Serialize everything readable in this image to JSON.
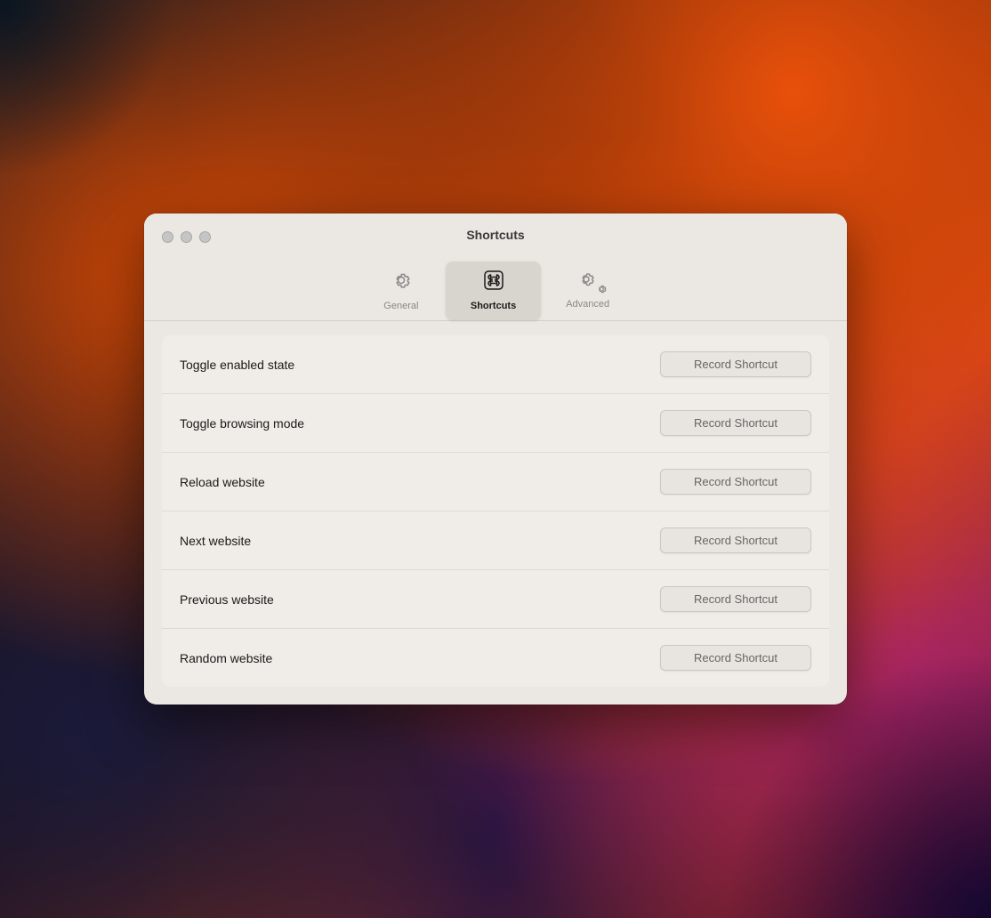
{
  "window": {
    "title": "Shortcuts",
    "traffic_lights": [
      "close",
      "minimize",
      "maximize"
    ]
  },
  "tabs": [
    {
      "id": "general",
      "label": "General",
      "icon": "gear",
      "active": false
    },
    {
      "id": "shortcuts",
      "label": "Shortcuts",
      "icon": "command",
      "active": true
    },
    {
      "id": "advanced",
      "label": "Advanced",
      "icon": "gear-advanced",
      "active": false
    }
  ],
  "shortcuts": [
    {
      "id": "toggle-enabled",
      "name": "Toggle enabled state",
      "button_label": "Record Shortcut"
    },
    {
      "id": "toggle-browsing",
      "name": "Toggle browsing mode",
      "button_label": "Record Shortcut"
    },
    {
      "id": "reload-website",
      "name": "Reload website",
      "button_label": "Record Shortcut"
    },
    {
      "id": "next-website",
      "name": "Next website",
      "button_label": "Record Shortcut"
    },
    {
      "id": "previous-website",
      "name": "Previous website",
      "button_label": "Record Shortcut"
    },
    {
      "id": "random-website",
      "name": "Random website",
      "button_label": "Record Shortcut"
    }
  ]
}
